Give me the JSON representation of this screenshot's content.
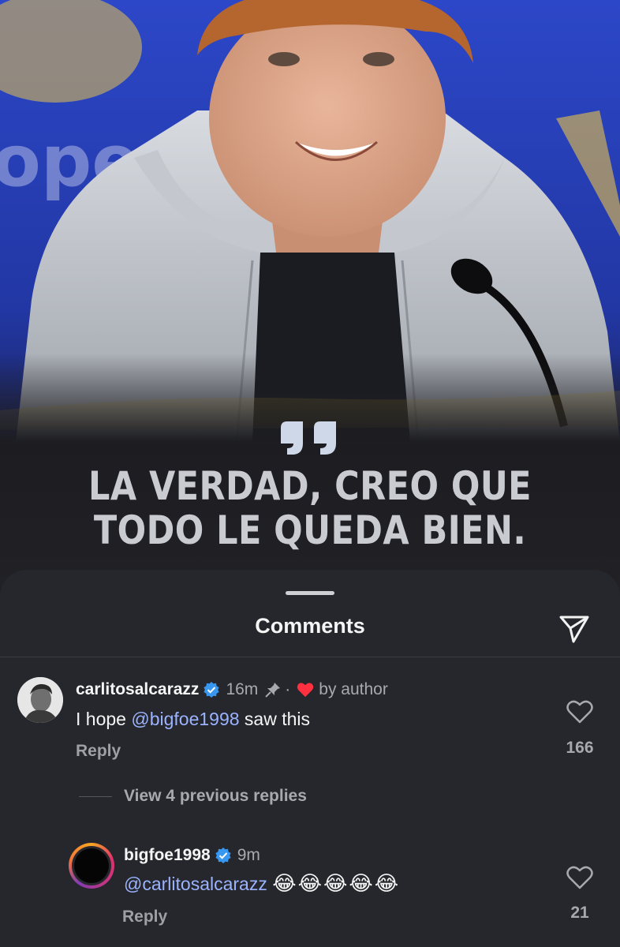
{
  "post": {
    "quote_lines": [
      "LA VERDAD, CREO QUE",
      "TODO LE QUEDA BIEN."
    ]
  },
  "comments_sheet": {
    "title": "Comments",
    "icons": [
      "share-icon"
    ]
  },
  "comments": [
    {
      "username": "carlitosalcarazz",
      "verified": true,
      "time": "16m",
      "pinned": true,
      "separator": "·",
      "liked_by_author_label": "by author",
      "text_mention": "@bigfoe1998",
      "text_rest": " saw this",
      "text_prefix": "I hope ",
      "reply_label": "Reply",
      "like_count": "166"
    }
  ],
  "view_replies_label": "View 4 previous replies",
  "reply": {
    "username": "bigfoe1998",
    "verified": true,
    "time": "9m",
    "text_mention": "@carlitosalcarazz",
    "emojis": "😂😂😂😂😂",
    "reply_label": "Reply",
    "like_count": "21"
  },
  "colors": {
    "background": "#25272c",
    "mention": "#9bb3ff",
    "verified": "#3897f0",
    "author_heart": "#ff3040"
  }
}
